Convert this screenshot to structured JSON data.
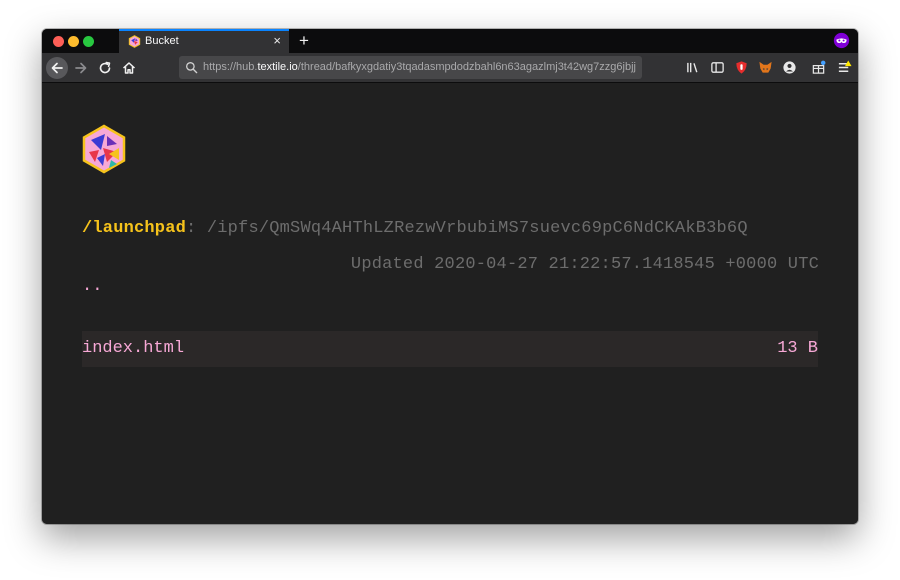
{
  "browser": {
    "tab": {
      "title": "Bucket",
      "close_glyph": "×"
    },
    "new_tab_glyph": "+",
    "url": {
      "prefix": "https://hub.",
      "host": "textile.io",
      "path": "/thread/bafkyxgdatiy3tqadasmpdodzbahl6n63agazlmj3t42wg7zzg6jbjj"
    },
    "colors": {
      "tab_accent": "#0a84ff",
      "traffic_close": "#fe5f57",
      "traffic_min": "#febc2e",
      "traffic_max": "#28c840"
    },
    "toolbar_icons": [
      "back-icon",
      "forward-icon",
      "reload-icon",
      "home-icon",
      "search-icon",
      "library-icon",
      "sidebar-icon",
      "shield-extension-icon",
      "metamask-extension-icon",
      "account-icon",
      "gift-icon",
      "menu-icon"
    ]
  },
  "bucket": {
    "name": "/launchpad",
    "separator": ":",
    "ipfs_path": " /ipfs/QmSWq4AHThLZRezwVrbubiMS7suevc69pC6NdCKAkB3b6Q",
    "updated": "Updated 2020-04-27 21:22:57.1418545 +0000 UTC",
    "parent_link": "..",
    "files": [
      {
        "name": "index.html",
        "size": "13 B"
      }
    ],
    "colors": {
      "name": "#f6c31b",
      "muted": "#6d6d6d",
      "link": "#f7a8d6",
      "row_bg": "#2b2828",
      "page_bg": "#202020"
    }
  }
}
